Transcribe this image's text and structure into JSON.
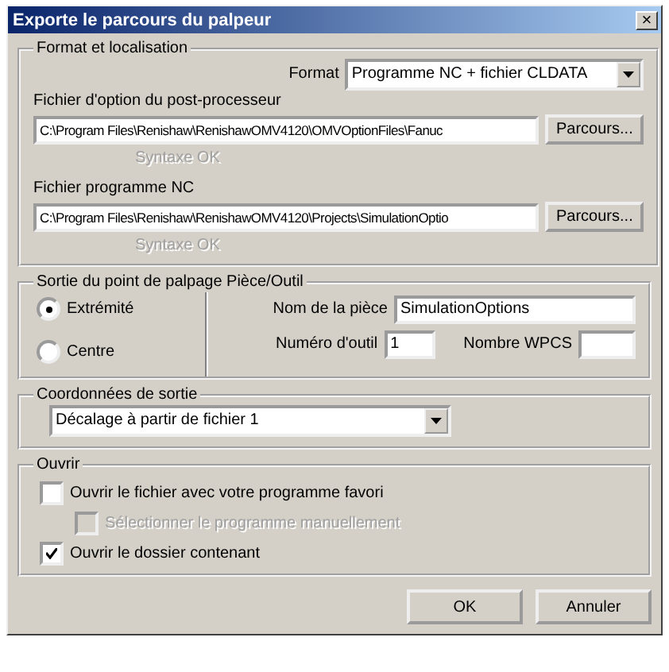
{
  "window": {
    "title": "Exporte le parcours du palpeur",
    "close": "×"
  },
  "format_group": {
    "title": "Format et localisation",
    "format_label": "Format",
    "format_value": "Programme NC + fichier CLDATA",
    "files": [
      {
        "label": "Fichier d'option du post-processeur",
        "path": "C:\\Program Files\\Renishaw\\RenishawOMV4120\\OMVOptionFiles\\Fanuc",
        "button": "Parcours...",
        "status": "Syntaxe OK",
        "status_disabled": true
      },
      {
        "label": "Fichier programme NC",
        "path": "C:\\Program Files\\Renishaw\\RenishawOMV4120\\Projects\\SimulationOptio",
        "button": "Parcours...",
        "status": "Syntaxe OK",
        "status_disabled": true
      }
    ]
  },
  "output_group": {
    "title": "Sortie du point de palpage Pièce/Outil",
    "radios": [
      {
        "label": "Extrémité",
        "selected": true
      },
      {
        "label": "Centre",
        "selected": false
      }
    ],
    "part_name_label": "Nom de la pièce",
    "part_name": "SimulationOptions",
    "tool_label": "Numéro d'outil",
    "tool": "1",
    "wpcs_label": "Nombre WPCS"
  },
  "coords_group": {
    "title": "Coordonnées de sortie",
    "value": "Décalage à partir de fichier 1"
  },
  "open_group": {
    "title": "Ouvrir",
    "checks": [
      {
        "label": "Ouvrir le fichier avec votre programme favori",
        "checked": false,
        "disabled": false,
        "children": [
          {
            "label": "Sélectionner le programme manuellement",
            "checked": false,
            "disabled": true
          }
        ]
      },
      {
        "label": "Ouvrir le dossier contenant",
        "checked": true,
        "disabled": false
      }
    ]
  },
  "buttons": [
    "OK",
    "Annuler"
  ]
}
